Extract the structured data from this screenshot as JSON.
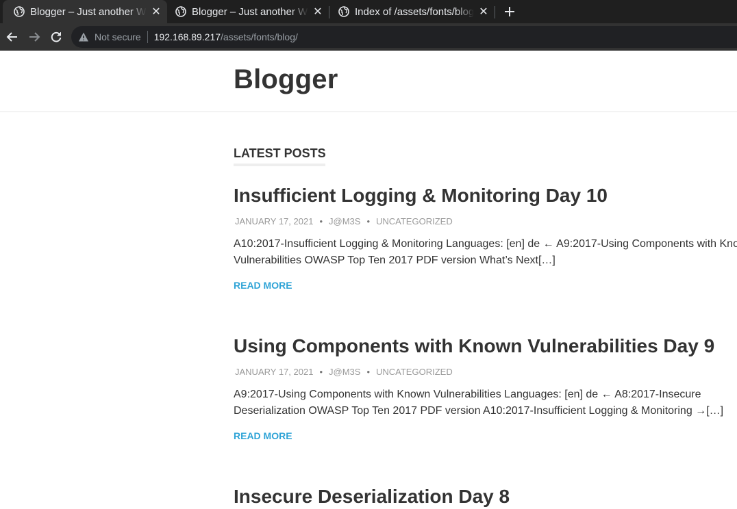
{
  "browser": {
    "tabs": [
      {
        "title": "Blogger – Just another WordPress site",
        "active": true
      },
      {
        "title": "Blogger – Just another WordPress site",
        "active": false
      },
      {
        "title": "Index of /assets/fonts/blog",
        "active": false
      }
    ],
    "address": {
      "security_label": "Not secure",
      "host": "192.168.89.217",
      "path": "/assets/fonts/blog/"
    }
  },
  "site": {
    "title": "Blogger"
  },
  "section": {
    "title": "LATEST POSTS"
  },
  "posts": [
    {
      "title": "Insufficient Logging & Monitoring Day 10",
      "date": "JANUARY 17, 2021",
      "author": "J@M3S",
      "category": "UNCATEGORIZED",
      "excerpt": "A10:2017-Insufficient Logging & Monitoring Languages: [en] de ← A9:2017-Using Components with Known Vulnerabilities OWASP Top Ten 2017 PDF version What’s Next[…]",
      "read_more": "READ MORE"
    },
    {
      "title": "Using Components with Known Vulnerabilities Day 9",
      "date": "JANUARY 17, 2021",
      "author": "J@M3S",
      "category": "UNCATEGORIZED",
      "excerpt": "A9:2017-Using Components with Known Vulnerabilities Languages: [en] de ← A8:2017-Insecure Deserialization OWASP Top Ten 2017 PDF version A10:2017-Insufficient Logging & Monitoring →[…]",
      "read_more": "READ MORE"
    },
    {
      "title": "Insecure Deserialization Day 8"
    }
  ],
  "colors": {
    "link": "#2ea3d6",
    "chrome_dark": "#1f1f1f",
    "chrome_toolbar": "#323232"
  }
}
